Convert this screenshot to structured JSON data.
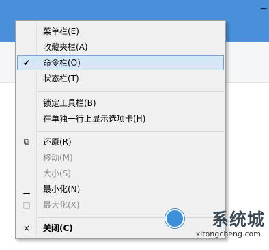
{
  "window": {
    "title_glyph": "−"
  },
  "menu": {
    "items": [
      {
        "label": "菜单栏(E)",
        "check": "",
        "enabled": true
      },
      {
        "label": "收藏夹栏(A)",
        "check": "",
        "enabled": true
      },
      {
        "label": "命令栏(O)",
        "check": "✔",
        "enabled": true,
        "highlighted": true
      },
      {
        "label": "状态栏(T)",
        "check": "",
        "enabled": true
      },
      {
        "label": "锁定工具栏(B)",
        "check": "",
        "enabled": true
      },
      {
        "label": "在单独一行上显示选项卡(H)",
        "check": "",
        "enabled": true
      },
      {
        "label": "还原(R)",
        "icon": "restore-icon",
        "icon_glyph": "⧉",
        "enabled": true
      },
      {
        "label": "移动(M)",
        "enabled": false
      },
      {
        "label": "大小(S)",
        "enabled": false
      },
      {
        "label": "最小化(N)",
        "icon": "minimize-icon",
        "icon_glyph": "▁",
        "enabled": true
      },
      {
        "label": "最大化(X)",
        "icon": "maximize-icon",
        "icon_glyph": "□",
        "enabled": false
      },
      {
        "label": "关闭(C)",
        "icon": "close-icon",
        "icon_glyph": "×",
        "enabled": true,
        "bold": true
      }
    ]
  },
  "watermark": {
    "name": "系统城",
    "url": "xitongcheng.com"
  },
  "colors": {
    "title_bar": "#4a8fd9",
    "menu_bg": "#f0f0f0",
    "highlight_bg": "#d5e6f7",
    "highlight_border": "#7da2ce"
  }
}
